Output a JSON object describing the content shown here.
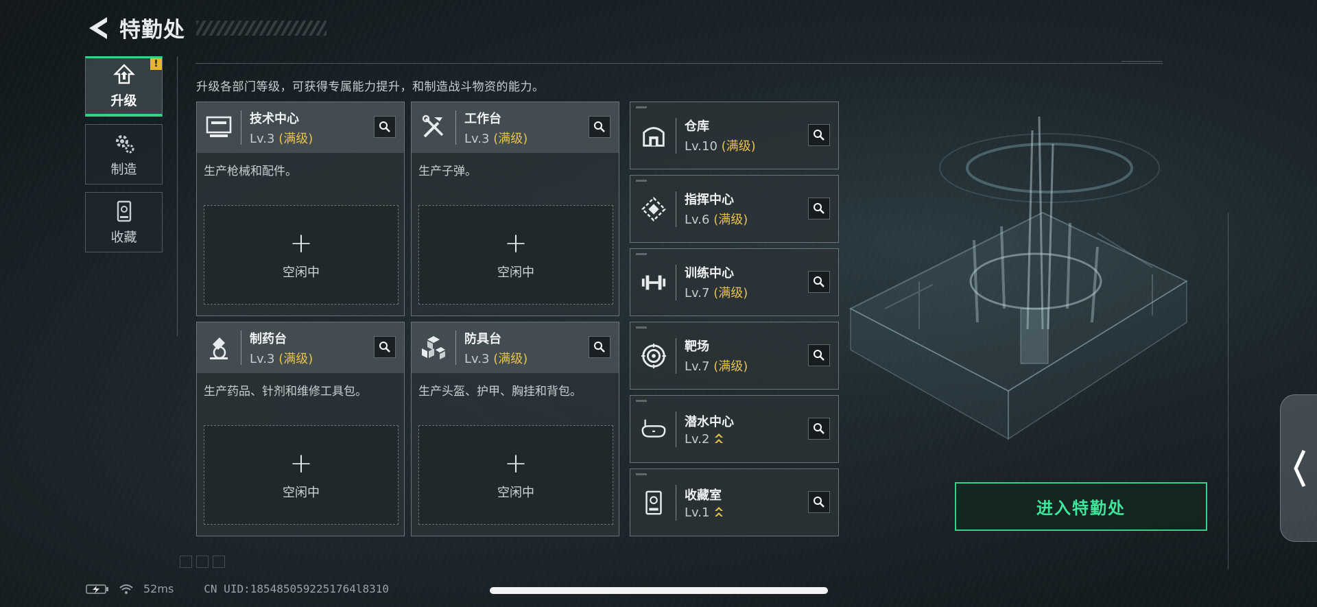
{
  "header": {
    "title": "特勤处"
  },
  "nav": {
    "items": [
      {
        "label": "升级",
        "icon": "upgrade-icon",
        "active": true,
        "alert": "!"
      },
      {
        "label": "制造",
        "icon": "gears-icon",
        "active": false
      },
      {
        "label": "收藏",
        "icon": "collection-icon",
        "active": false
      }
    ]
  },
  "intro": "升级各部门等级，可获得专属能力提升，和制造战斗物资的能力。",
  "departments": [
    {
      "name": "技术中心",
      "level": "Lv.3",
      "status": "(满级)",
      "desc": "生产枪械和配件。",
      "slot_label": "空闲中",
      "icon": "monitor-icon"
    },
    {
      "name": "工作台",
      "level": "Lv.3",
      "status": "(满级)",
      "desc": "生产子弹。",
      "slot_label": "空闲中",
      "icon": "tools-icon"
    },
    {
      "name": "制药台",
      "level": "Lv.3",
      "status": "(满级)",
      "desc": "生产药品、针剂和维修工具包。",
      "slot_label": "空闲中",
      "icon": "microscope-icon"
    },
    {
      "name": "防具台",
      "level": "Lv.3",
      "status": "(满级)",
      "desc": "生产头盔、护甲、胸挂和背包。",
      "slot_label": "空闲中",
      "icon": "armor-boxes-icon"
    }
  ],
  "facilities": [
    {
      "name": "仓库",
      "level": "Lv.10",
      "status": "(满级)",
      "icon": "warehouse-icon"
    },
    {
      "name": "指挥中心",
      "level": "Lv.6",
      "status": "(满级)",
      "icon": "command-chip-icon"
    },
    {
      "name": "训练中心",
      "level": "Lv.7",
      "status": "(满级)",
      "icon": "dumbbell-icon"
    },
    {
      "name": "靶场",
      "level": "Lv.7",
      "status": "(满级)",
      "icon": "target-icon"
    },
    {
      "name": "潜水中心",
      "level": "Lv.2",
      "status": "",
      "upgradable": true,
      "icon": "diving-mask-icon"
    },
    {
      "name": "收藏室",
      "level": "Lv.1",
      "status": "",
      "upgradable": true,
      "icon": "collection-room-icon"
    }
  ],
  "enter_button": "进入特勤处",
  "status_bar": {
    "ping": "52ms",
    "uid": "CN UID:1854850592251764l8310"
  },
  "colors": {
    "accent": "#2fd48a",
    "maxed": "#e9c14e",
    "alert": "#e3b530"
  }
}
